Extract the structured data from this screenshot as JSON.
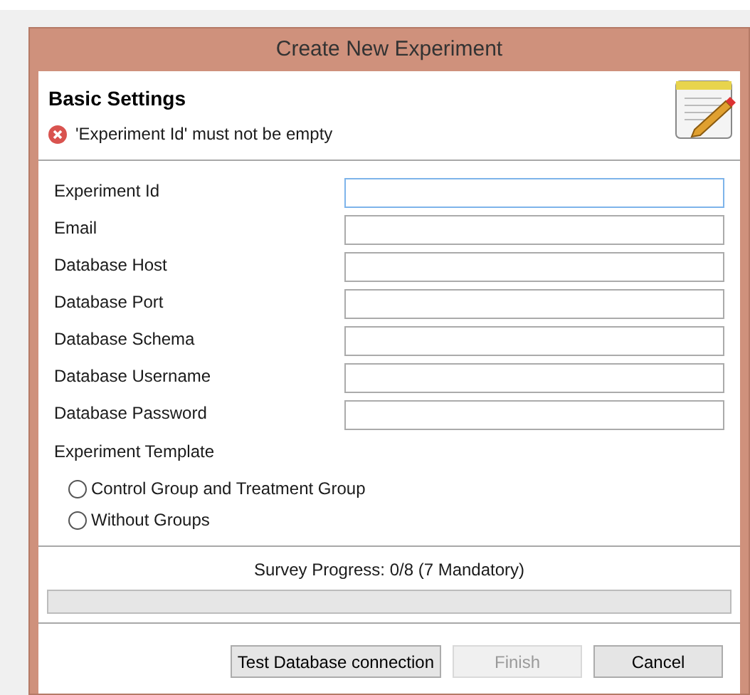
{
  "window": {
    "title": "Create New Experiment"
  },
  "header": {
    "title": "Basic Settings",
    "error": "'Experiment Id' must not be empty"
  },
  "fields": [
    {
      "label": "Experiment Id",
      "focused": true
    },
    {
      "label": "Email",
      "focused": false
    },
    {
      "label": "Database Host",
      "focused": false
    },
    {
      "label": "Database Port",
      "focused": false
    },
    {
      "label": "Database Schema",
      "focused": false
    },
    {
      "label": "Database Username",
      "focused": false
    },
    {
      "label": "Database Password",
      "focused": false
    }
  ],
  "template": {
    "label": "Experiment Template",
    "options": [
      {
        "label": "Control Group and Treatment Group",
        "selected": false
      },
      {
        "label": "Without Groups",
        "selected": false
      }
    ]
  },
  "progress": {
    "label": "Survey Progress: 0/8 (7 Mandatory)",
    "level": 0
  },
  "buttons": [
    {
      "label": "Test Database connection",
      "disabled": false
    },
    {
      "label": "Finish",
      "disabled": true
    },
    {
      "label": "Cancel",
      "disabled": false
    }
  ]
}
